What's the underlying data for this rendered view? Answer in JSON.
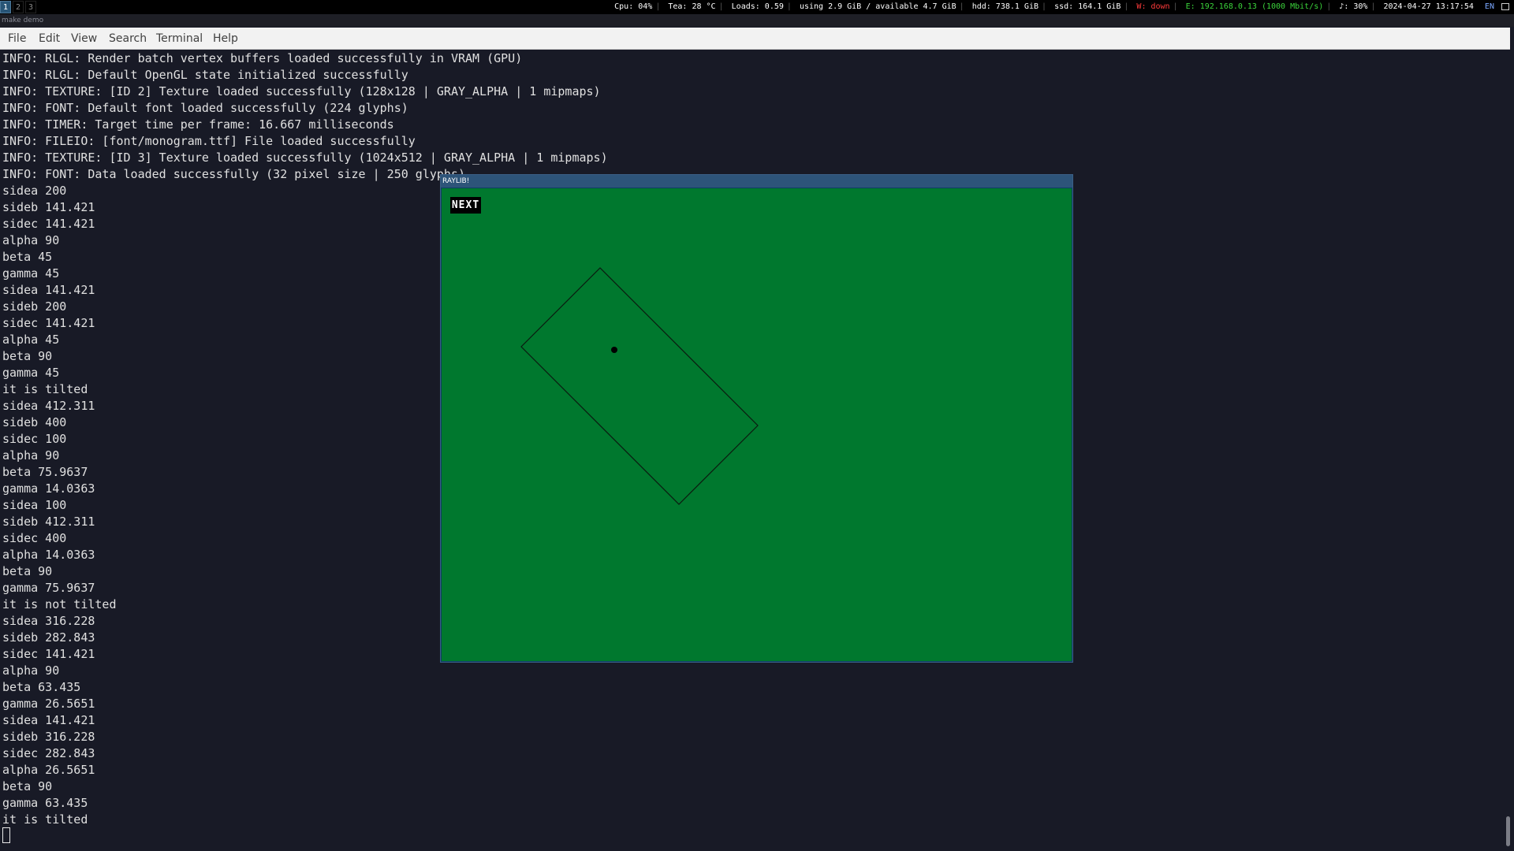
{
  "topbar": {
    "workspaces": [
      "1",
      "2",
      "3"
    ],
    "active_workspace": "1",
    "status": {
      "cpu": "Cpu: 04%",
      "temp": "Tea: 28 °C",
      "loads": "Loads: 0.59",
      "memory": "using 2.9 GiB / available 4.7 GiB",
      "hdd": "hdd: 738.1 GiB",
      "ssd": "ssd: 164.1 GiB",
      "wifi": "W: down",
      "ethernet": "E: 192.168.0.13 (1000 Mbit/s)",
      "volume": "♪: 30%",
      "datetime": "2024-04-27 13:17:54",
      "lang": "EN"
    },
    "colors": {
      "active_ws": "#285577",
      "wifi_down": "#ff3b3b",
      "eth_up": "#3bd43b"
    }
  },
  "window_title": "make demo",
  "menubar": {
    "items": [
      "File",
      "Edit",
      "View",
      "Search",
      "Terminal",
      "Help"
    ]
  },
  "terminal": {
    "lines": [
      "INFO: RLGL: Render batch vertex buffers loaded successfully in VRAM (GPU)",
      "INFO: RLGL: Default OpenGL state initialized successfully",
      "INFO: TEXTURE: [ID 2] Texture loaded successfully (128x128 | GRAY_ALPHA | 1 mipmaps)",
      "INFO: FONT: Default font loaded successfully (224 glyphs)",
      "INFO: TIMER: Target time per frame: 16.667 milliseconds",
      "INFO: FILEIO: [font/monogram.ttf] File loaded successfully",
      "INFO: TEXTURE: [ID 3] Texture loaded successfully (1024x512 | GRAY_ALPHA | 1 mipmaps)",
      "INFO: FONT: Data loaded successfully (32 pixel size | 250 glyphs)",
      "sidea 200",
      "sideb 141.421",
      "sidec 141.421",
      "alpha 90",
      "beta 45",
      "gamma 45",
      "sidea 141.421",
      "sideb 200",
      "sidec 141.421",
      "alpha 45",
      "beta 90",
      "gamma 45",
      "it is tilted",
      "sidea 412.311",
      "sideb 400",
      "sidec 100",
      "alpha 90",
      "beta 75.9637",
      "gamma 14.0363",
      "sidea 100",
      "sideb 412.311",
      "sidec 400",
      "alpha 14.0363",
      "beta 90",
      "gamma 75.9637",
      "it is not tilted",
      "sidea 316.228",
      "sideb 282.843",
      "sidec 141.421",
      "alpha 90",
      "beta 63.435",
      "gamma 26.5651",
      "sidea 141.421",
      "sideb 316.228",
      "sidec 282.843",
      "alpha 26.5651",
      "beta 90",
      "gamma 63.435",
      "it is tilted"
    ],
    "background": "#181a26",
    "foreground": "#e0e0e0"
  },
  "raylib": {
    "title": "RAYLIB!",
    "next_label": "NEXT",
    "canvas_color": "#00782e"
  }
}
